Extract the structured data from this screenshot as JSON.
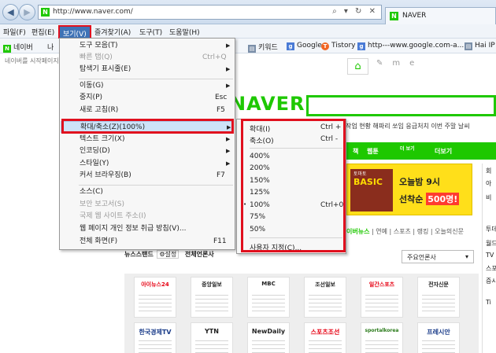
{
  "browser": {
    "url": "http://www.naver.com/",
    "url_icons": "⌕ ▾ ↻ ✕",
    "tab_title": "NAVER",
    "favicon_letter": "N"
  },
  "menubar": {
    "items": [
      "파일(F)",
      "편집(E)",
      "보기(V)",
      "즐겨찾기(A)",
      "도구(T)",
      "도움말(H)"
    ]
  },
  "favorites": {
    "items": [
      "네이버",
      "나",
      "키워드",
      "Google",
      "Tistory",
      "http---www.google.com-a...",
      "Hai IP"
    ]
  },
  "view_menu": {
    "items": [
      {
        "label": "도구 모음(T)",
        "shortcut": "",
        "submenu": true,
        "disabled": false
      },
      {
        "label": "빠른 탭(Q)",
        "shortcut": "Ctrl+Q",
        "submenu": false,
        "disabled": true
      },
      {
        "label": "탐색기 표시줄(E)",
        "shortcut": "",
        "submenu": true,
        "disabled": false
      },
      {
        "label": "이동(G)",
        "shortcut": "",
        "submenu": true,
        "disabled": false
      },
      {
        "label": "중지(P)",
        "shortcut": "Esc",
        "submenu": false,
        "disabled": false
      },
      {
        "label": "새로 고침(R)",
        "shortcut": "F5",
        "submenu": false,
        "disabled": false
      },
      {
        "label": "확대/축소(Z)(100%)",
        "shortcut": "",
        "submenu": true,
        "disabled": false
      },
      {
        "label": "텍스트 크기(X)",
        "shortcut": "",
        "submenu": true,
        "disabled": false
      },
      {
        "label": "인코딩(D)",
        "shortcut": "",
        "submenu": true,
        "disabled": false
      },
      {
        "label": "스타일(Y)",
        "shortcut": "",
        "submenu": true,
        "disabled": false
      },
      {
        "label": "커서 브라우징(B)",
        "shortcut": "F7",
        "submenu": false,
        "disabled": false
      },
      {
        "label": "소스(C)",
        "shortcut": "",
        "submenu": false,
        "disabled": false
      },
      {
        "label": "보안 보고서(S)",
        "shortcut": "",
        "submenu": false,
        "disabled": true
      },
      {
        "label": "국제 웹 사이트 주소(I)",
        "shortcut": "",
        "submenu": false,
        "disabled": true
      },
      {
        "label": "웹 페이지 개인 정보 취급 방침(V)...",
        "shortcut": "",
        "submenu": false,
        "disabled": false
      },
      {
        "label": "전체 화면(F)",
        "shortcut": "F11",
        "submenu": false,
        "disabled": false
      }
    ]
  },
  "zoom_menu": {
    "items": [
      {
        "label": "확대(I)",
        "shortcut": "Ctrl +"
      },
      {
        "label": "축소(O)",
        "shortcut": "Ctrl -"
      },
      {
        "label": "400%",
        "shortcut": ""
      },
      {
        "label": "200%",
        "shortcut": ""
      },
      {
        "label": "150%",
        "shortcut": ""
      },
      {
        "label": "125%",
        "shortcut": ""
      },
      {
        "label": "100%",
        "shortcut": "Ctrl+0",
        "checked": true
      },
      {
        "label": "75%",
        "shortcut": ""
      },
      {
        "label": "50%",
        "shortcut": ""
      },
      {
        "label": "사용자 지정(C)...",
        "shortcut": ""
      }
    ],
    "check_mark": "•"
  },
  "page": {
    "hint": "네이버를 시작페이지로",
    "logo": "NAVER",
    "hotlinks": "작업 현황  해파리 쏘임 응급처치  이번 주말 날씨",
    "greenbar": [
      "책",
      "웹툰",
      "더보기"
    ],
    "greenbar_small": "더 보기",
    "banner": {
      "ad_title": "토마토",
      "ad_big": "BASIC",
      "line1": "오늘밤 9시",
      "line2a": "선착순",
      "line2b": "500명!"
    },
    "section_tabs": [
      "이버뉴스",
      "연예",
      "스포츠",
      "랭킹",
      "오늘의신문"
    ],
    "newsstand": "뉴스스탠드",
    "settings_chip": "설정",
    "all_press": "전체언론사",
    "sort_label": "주요언론사",
    "press_row1": [
      "아이뉴스24",
      "중앙일보",
      "MBC",
      "조선일보",
      "일간스포츠",
      "전자신문"
    ],
    "press_row2": [
      "한국경제TV",
      "YTN",
      "NewDaily",
      "스포츠조선",
      "sportalkorea",
      "프레시안"
    ],
    "right_col": [
      "회",
      "아",
      "비",
      "",
      "투데",
      "월드",
      "TV",
      "스포",
      "증시",
      "Ti"
    ]
  }
}
